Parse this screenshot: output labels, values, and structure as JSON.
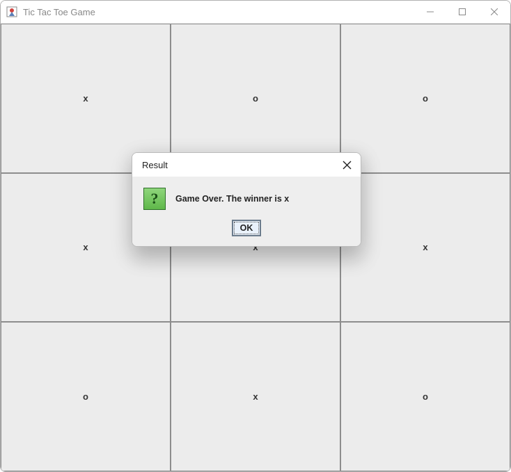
{
  "window": {
    "title": "Tic Tac Toe Game"
  },
  "board": {
    "cells": [
      "x",
      "o",
      "o",
      "x",
      "x",
      "x",
      "o",
      "x",
      "o"
    ]
  },
  "dialog": {
    "title": "Result",
    "message": "Game Over. The winner is x",
    "ok_label": "OK"
  }
}
